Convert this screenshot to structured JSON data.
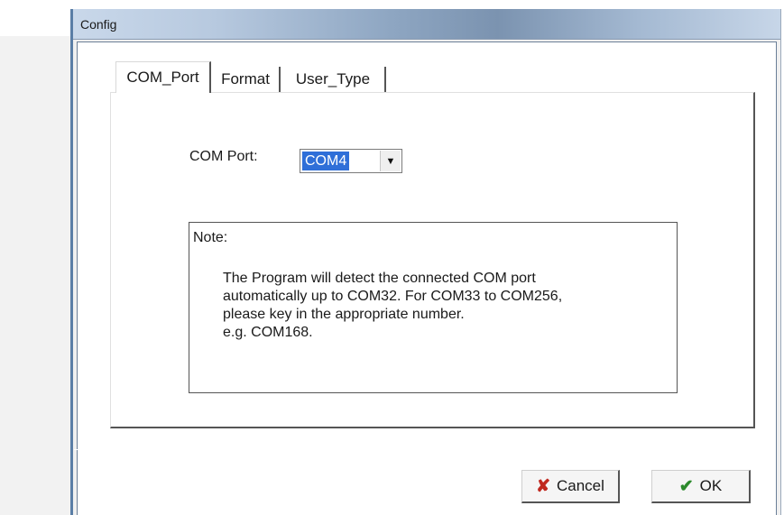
{
  "window": {
    "title": "Config"
  },
  "tabs": [
    {
      "label": "COM_Port",
      "active": true
    },
    {
      "label": "Format",
      "active": false
    },
    {
      "label": "User_Type",
      "active": false
    }
  ],
  "com_port": {
    "label": "COM Port:",
    "selected": "COM4"
  },
  "note": {
    "title": "Note:",
    "lines": [
      "The Program will detect the connected COM port",
      "automatically up to COM32. For COM33 to COM256,",
      "please key in the appropriate number.",
      "e.g. COM168."
    ]
  },
  "buttons": {
    "cancel": {
      "label": "Cancel",
      "icon": "cancel-x-icon",
      "icon_color": "#c0281f"
    },
    "ok": {
      "label": "OK",
      "icon": "checkmark-icon",
      "icon_color": "#2c8a2c"
    }
  },
  "colors": {
    "selection_highlight": "#2f6fd8",
    "title_gradient_dark": "#7b93b0"
  }
}
